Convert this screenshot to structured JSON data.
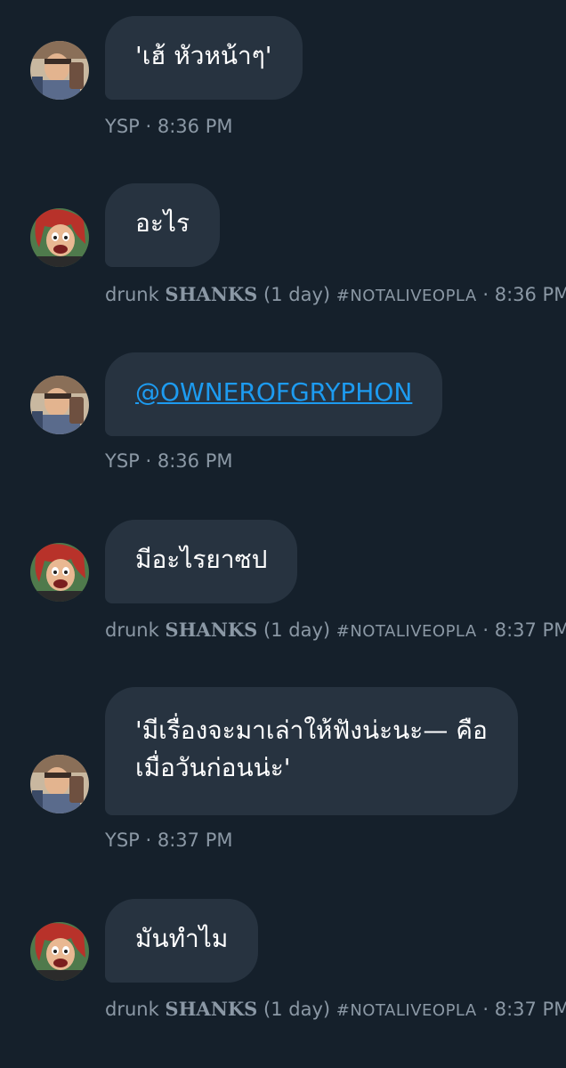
{
  "messages": [
    {
      "sender": "YSP",
      "avatar_icon": "ysp-avatar-icon",
      "text": "'เฮ้ หัวหน้าๆ'",
      "time": "8:36 PM"
    },
    {
      "sender_prefix": "drunk ",
      "sender_bold": "SHANKS",
      "sender_suffix": " (1 day) ",
      "tag": "#NOTALIVEOPLA",
      "avatar_icon": "shanks-avatar-icon",
      "text": "อะไร",
      "time": "8:36 PM"
    },
    {
      "sender": "YSP",
      "avatar_icon": "ysp-avatar-icon",
      "link": "@OWNEROFGRYPHON",
      "time": "8:36 PM"
    },
    {
      "sender_prefix": "drunk ",
      "sender_bold": "SHANKS",
      "sender_suffix": " (1 day) ",
      "tag": "#NOTALIVEOPLA",
      "avatar_icon": "shanks-avatar-icon",
      "text": "มีอะไรยาซป",
      "time": "8:37 PM"
    },
    {
      "sender": "YSP",
      "avatar_icon": "ysp-avatar-icon",
      "text_line1": "'มีเรื่องจะมาเล่าให้ฟังน่ะนะ— คือ",
      "text_line2": "เมื่อวันก่อนน่ะ'",
      "time": "8:37 PM"
    },
    {
      "sender_prefix": "drunk ",
      "sender_bold": "SHANKS",
      "sender_suffix": " (1 day) ",
      "tag": "#NOTALIVEOPLA",
      "avatar_icon": "shanks-avatar-icon",
      "text": "มันทำไม",
      "time": "8:37 PM"
    }
  ],
  "separator": " · "
}
